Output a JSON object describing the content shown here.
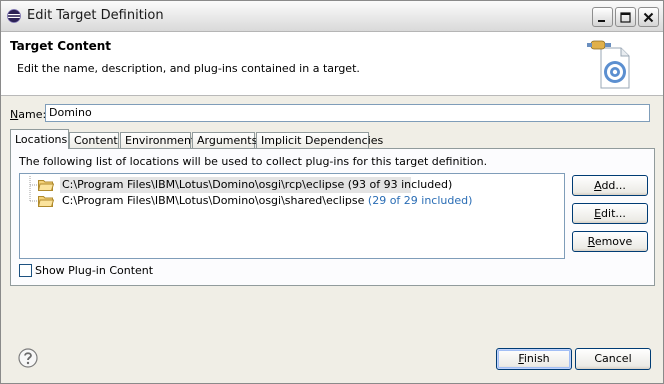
{
  "window": {
    "title": "Edit Target Definition"
  },
  "banner": {
    "title": "Target Content",
    "description": "Edit the name, description, and plug-ins contained in a target."
  },
  "name_field": {
    "label_first": "N",
    "label_rest": "ame:",
    "value": "Domino"
  },
  "tabs": [
    {
      "label": "Locations",
      "active": true
    },
    {
      "label": "Content",
      "active": false
    },
    {
      "label": "Environment",
      "active": false
    },
    {
      "label": "Arguments",
      "active": false
    },
    {
      "label": "Implicit Dependencies",
      "active": false
    }
  ],
  "locations_panel": {
    "description": "The following list of locations will be used to collect plug-ins for this target definition.",
    "locations": [
      {
        "path": "C:\\Program Files\\IBM\\Lotus\\Domino\\osgi\\rcp\\eclipse",
        "count": "(93 of 93 included)",
        "selected": true
      },
      {
        "path": "C:\\Program Files\\IBM\\Lotus\\Domino\\osgi\\shared\\eclipse",
        "count": "(29 of 29 included)",
        "selected": false
      }
    ],
    "buttons": {
      "add_first": "A",
      "add_rest": "dd...",
      "edit_first": "E",
      "edit_rest": "dit...",
      "remove_first": "R",
      "remove_rest": "emove"
    },
    "show_content_label": "Show Plug-in Content",
    "show_content_checked": false
  },
  "footer": {
    "finish_first": "F",
    "finish_rest": "inish",
    "cancel": "Cancel"
  },
  "icons": {
    "app": "eclipse-icon",
    "banner": "target-definition-icon",
    "folder": "folder-icon",
    "help": "help-icon"
  },
  "colors": {
    "count_blue": "#2a6db5",
    "button_border": "#003c74"
  }
}
